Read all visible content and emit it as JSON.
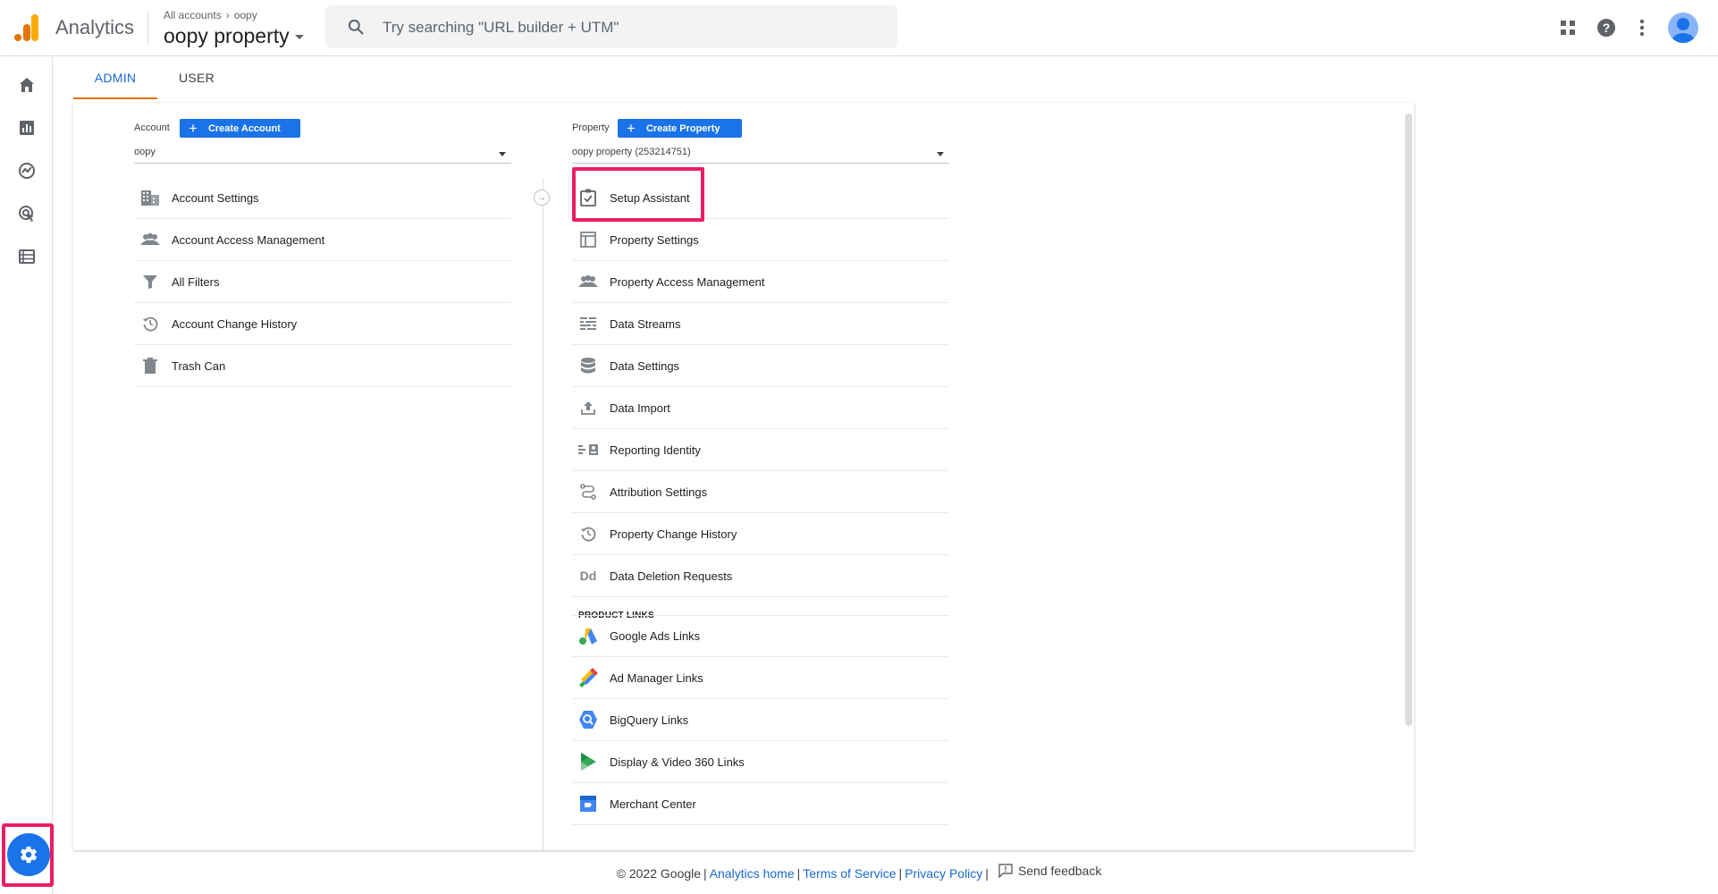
{
  "header": {
    "app_name": "Analytics",
    "breadcrumb": [
      "All accounts",
      "oopy"
    ],
    "breadcrumb_sep": "›",
    "property_name": "oopy property",
    "search_placeholder": "Try searching \"URL builder + UTM\""
  },
  "tabs": [
    {
      "label": "ADMIN",
      "active": true
    },
    {
      "label": "USER",
      "active": false
    }
  ],
  "account": {
    "label": "Account",
    "create_label": "Create Account",
    "selected": "oopy",
    "items": [
      {
        "label": "Account Settings",
        "icon": "building-icon"
      },
      {
        "label": "Account Access Management",
        "icon": "people-icon"
      },
      {
        "label": "All Filters",
        "icon": "filter-icon"
      },
      {
        "label": "Account Change History",
        "icon": "history-icon"
      },
      {
        "label": "Trash Can",
        "icon": "trash-icon"
      }
    ]
  },
  "property": {
    "label": "Property",
    "create_label": "Create Property",
    "selected": "oopy property (253214751)",
    "items": [
      {
        "label": "Setup Assistant",
        "icon": "checkbox-icon"
      },
      {
        "label": "Property Settings",
        "icon": "layout-icon"
      },
      {
        "label": "Property Access Management",
        "icon": "people-icon"
      },
      {
        "label": "Data Streams",
        "icon": "streams-icon"
      },
      {
        "label": "Data Settings",
        "icon": "database-icon"
      },
      {
        "label": "Data Import",
        "icon": "upload-icon"
      },
      {
        "label": "Reporting Identity",
        "icon": "identity-icon"
      },
      {
        "label": "Attribution Settings",
        "icon": "attribution-icon"
      },
      {
        "label": "Property Change History",
        "icon": "history-icon"
      },
      {
        "label": "Data Deletion Requests",
        "icon": "dd-icon",
        "icon_text": "Dd"
      }
    ],
    "product_links_heading": "PRODUCT LINKS",
    "product_links": [
      {
        "label": "Google Ads Links",
        "icon": "google-ads-icon"
      },
      {
        "label": "Ad Manager Links",
        "icon": "ad-manager-icon"
      },
      {
        "label": "BigQuery Links",
        "icon": "bigquery-icon"
      },
      {
        "label": "Display & Video 360 Links",
        "icon": "dv360-icon"
      },
      {
        "label": "Merchant Center",
        "icon": "merchant-center-icon"
      }
    ]
  },
  "footer": {
    "copyright": "© 2022 Google",
    "links": [
      "Analytics home",
      "Terms of Service",
      "Privacy Policy"
    ],
    "feedback": "Send feedback"
  },
  "colors": {
    "accent": "#1a73e8",
    "highlight": "#ea1e63",
    "active_tab_underline": "#e8710a",
    "logo_orange": "#f9ab00",
    "logo_dark_orange": "#e37400"
  }
}
